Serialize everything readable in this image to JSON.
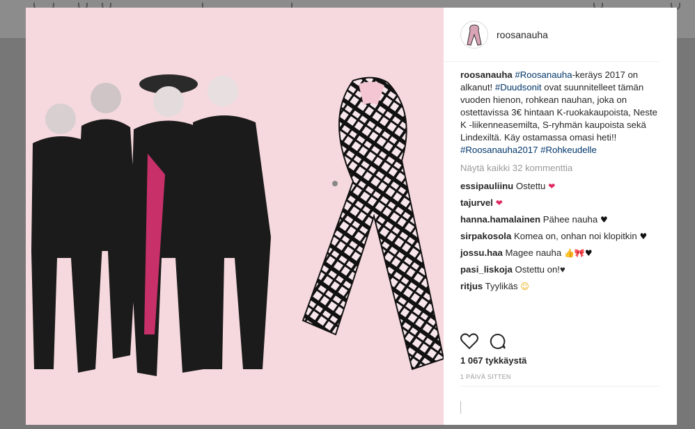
{
  "post": {
    "author": "roosanauha",
    "caption_user": "roosanauha",
    "caption_parts": [
      {
        "text": "#Roosanauha",
        "tag": true
      },
      {
        "text": "-keräys 2017 on alkanut! ",
        "tag": false
      },
      {
        "text": "#Duudsonit",
        "tag": true
      },
      {
        "text": " ovat suunnitelleet tämän vuoden hienon, rohkean nauhan, joka on ostettavissa 3€ hintaan K-ruokakaupoista, Neste K -liikenneasemilta, S-ryhmän kaupoista sekä Lindexiltä. Käy ostamassa omasi heti!! ",
        "tag": false
      },
      {
        "text": "#Roosanauha2017",
        "tag": true
      },
      {
        "text": " ",
        "tag": false
      },
      {
        "text": "#Rohkeudelle",
        "tag": true
      }
    ],
    "view_all": "Näytä kaikki 32 kommenttia",
    "comments": [
      {
        "user": "essipauliinu",
        "text": "Ostettu",
        "emoji": "❤",
        "emoji_color": "#e0245e"
      },
      {
        "user": "tajurvel",
        "text": "",
        "emoji": "❤",
        "emoji_color": "#e0245e"
      },
      {
        "user": "hanna.hamalainen",
        "text": "Pähee nauha",
        "emoji": "♥",
        "emoji_color": "#111111"
      },
      {
        "user": "sirpakosola",
        "text": "Komea on, onhan noi klopitkin",
        "emoji": "♥",
        "emoji_color": "#111111"
      },
      {
        "user": "jossu.haa",
        "text": "Magee nauha",
        "emoji": "👍🎀♥",
        "emoji_color": "#111111"
      },
      {
        "user": "pasi_liskoja",
        "text": "Ostettu on!♥",
        "emoji": "",
        "emoji_color": "#111111"
      },
      {
        "user": "ritjus",
        "text": "Tyylikäs",
        "emoji": "☺",
        "emoji_color": "#e8a800"
      }
    ],
    "likes": "1 067 tykkäystä",
    "timestamp": "1 PÄIVÄ SITTEN"
  },
  "icons": {
    "like": "heart-icon",
    "comment": "comment-icon"
  },
  "colors": {
    "media_bg": "#f6d9de",
    "hashtag": "#003569",
    "ribbon_pink": "#f4c6d3"
  }
}
